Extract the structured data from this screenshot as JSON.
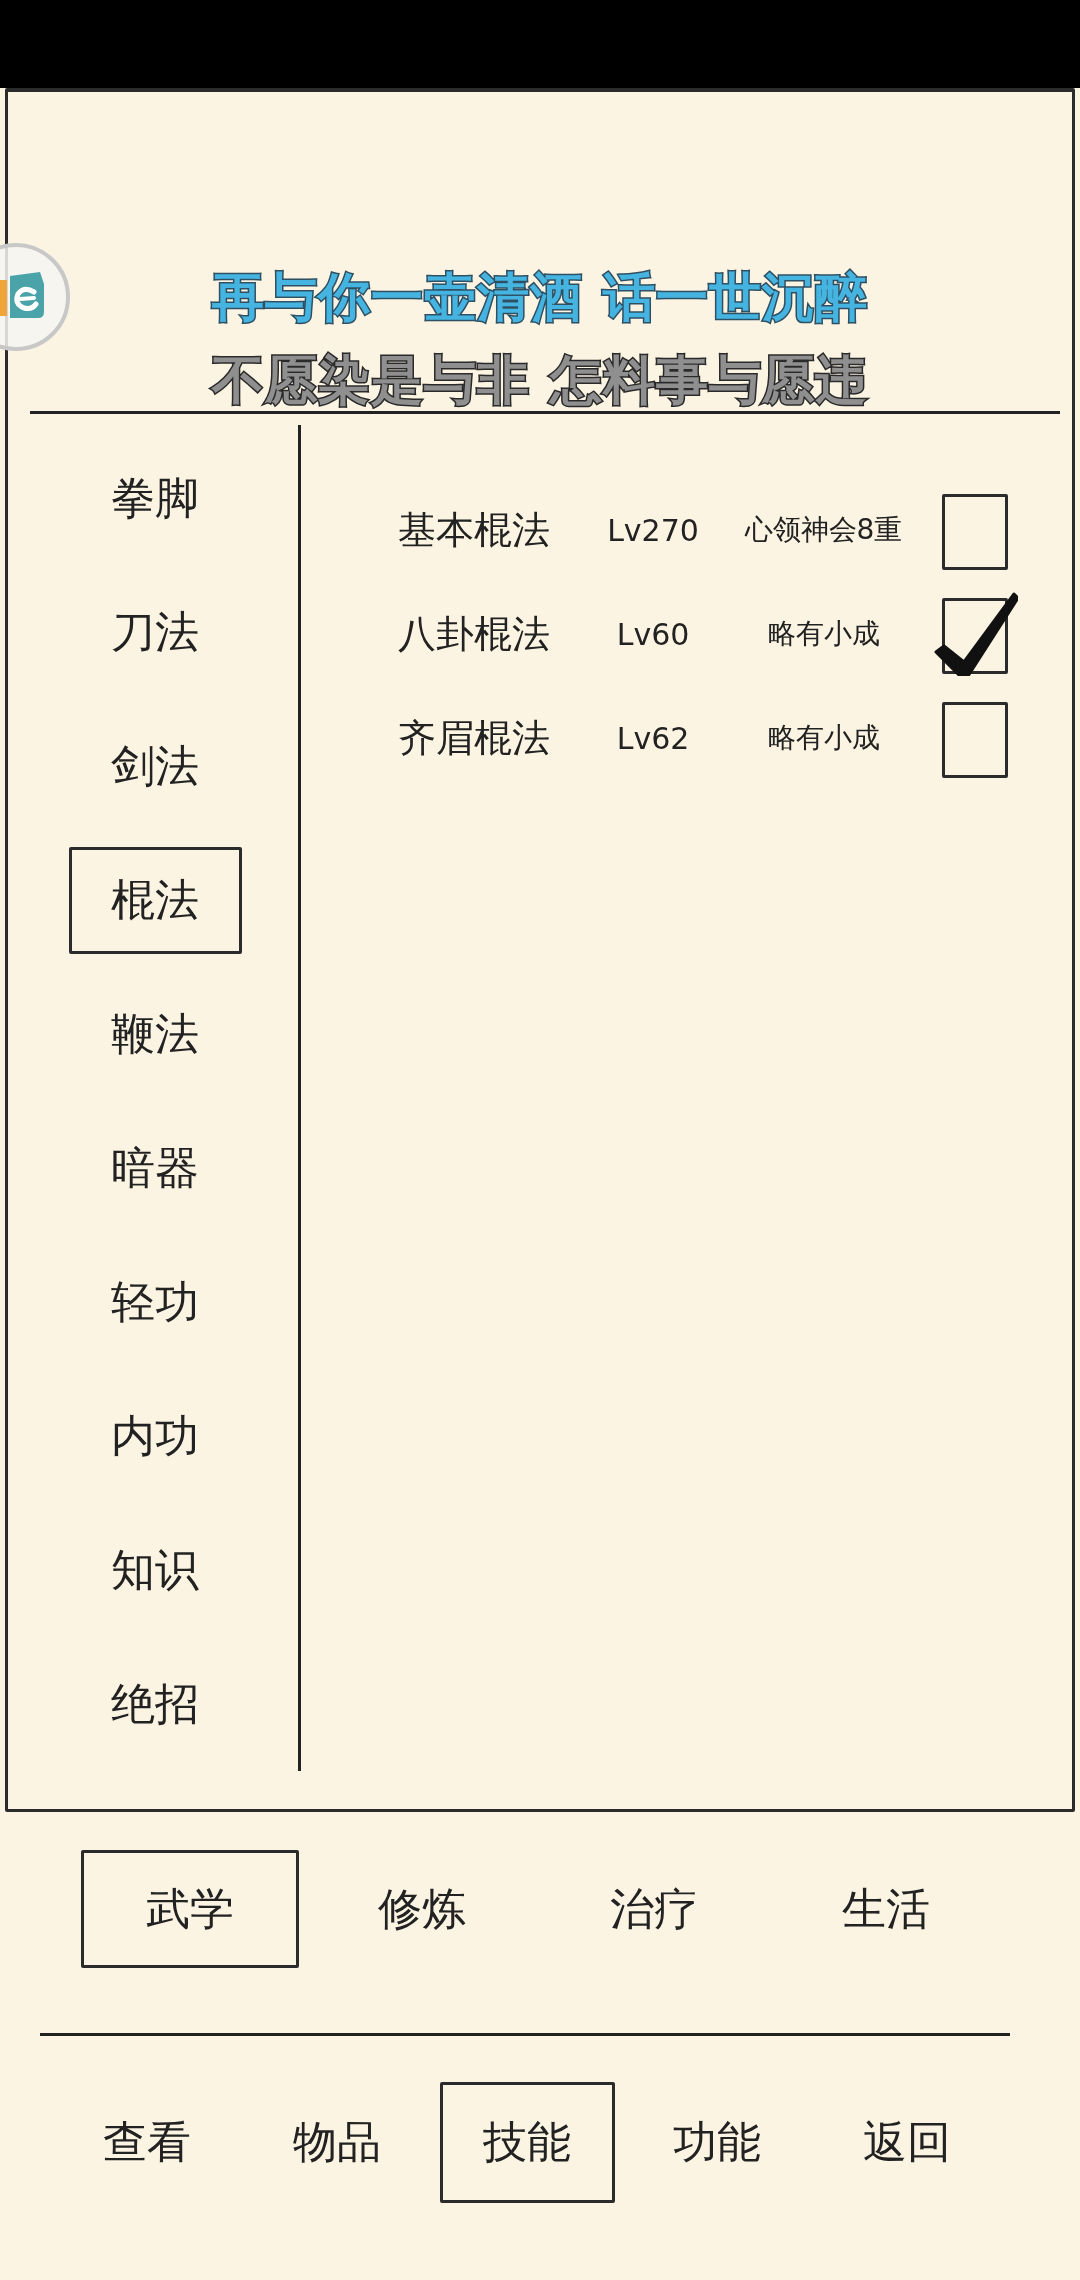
{
  "lyrics": [
    {
      "text": "再与你一壶清酒 话一世沉醉",
      "kind": "current"
    },
    {
      "text": "不愿染是与非 怎料事与愿违",
      "kind": "next"
    }
  ],
  "categories": [
    {
      "label": "拳脚",
      "selected": false
    },
    {
      "label": "刀法",
      "selected": false
    },
    {
      "label": "剑法",
      "selected": false
    },
    {
      "label": "棍法",
      "selected": true
    },
    {
      "label": "鞭法",
      "selected": false
    },
    {
      "label": "暗器",
      "selected": false
    },
    {
      "label": "轻功",
      "selected": false
    },
    {
      "label": "内功",
      "selected": false
    },
    {
      "label": "知识",
      "selected": false
    },
    {
      "label": "绝招",
      "selected": false
    }
  ],
  "skills": [
    {
      "name": "基本棍法",
      "grade": "Lv270",
      "realm": "心领神会8重",
      "checked": false
    },
    {
      "name": "八卦棍法",
      "grade": "Lv60",
      "realm": "略有小成",
      "checked": true
    },
    {
      "name": "齐眉棍法",
      "grade": "Lv62",
      "realm": "略有小成",
      "checked": false
    }
  ],
  "tabs": [
    {
      "label": "武学",
      "selected": true
    },
    {
      "label": "修炼",
      "selected": false
    },
    {
      "label": "治疗",
      "selected": false
    },
    {
      "label": "生活",
      "selected": false
    }
  ],
  "nav": [
    {
      "label": "查看",
      "selected": false
    },
    {
      "label": "物品",
      "selected": false
    },
    {
      "label": "技能",
      "selected": true
    },
    {
      "label": "功能",
      "selected": false
    },
    {
      "label": "返回",
      "selected": false
    }
  ]
}
